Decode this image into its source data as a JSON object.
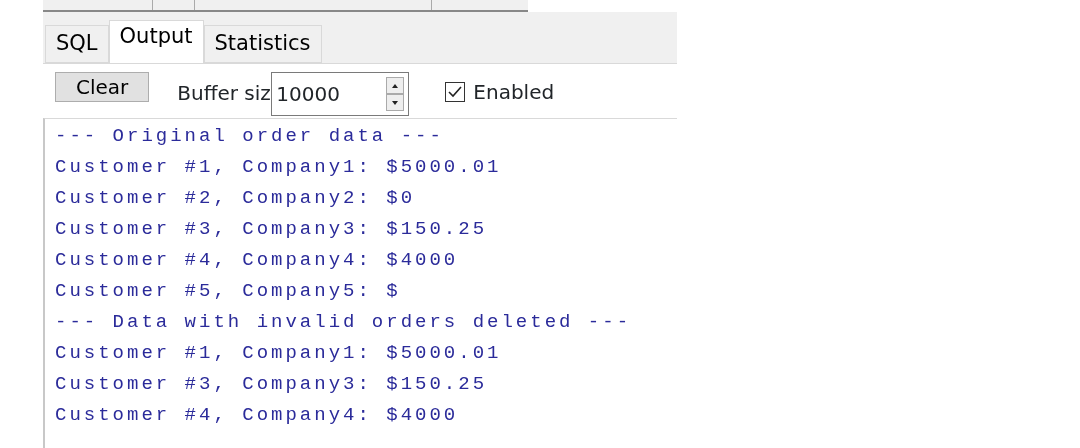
{
  "tabs": [
    {
      "label": "SQL",
      "selected": false
    },
    {
      "label": "Output",
      "selected": true
    },
    {
      "label": "Statistics",
      "selected": false
    }
  ],
  "toolbar": {
    "clear_button": "Clear",
    "buffer_label": "Buffer siz",
    "buffer_size": "10000",
    "enabled": {
      "label": "Enabled",
      "checked": true
    }
  },
  "output_lines": [
    "--- Original order data ---",
    "Customer #1, Company1: $5000.01",
    "Customer #2, Company2: $0",
    "Customer #3, Company3: $150.25",
    "Customer #4, Company4: $4000",
    "Customer #5, Company5: $",
    "--- Data with invalid orders deleted ---",
    "Customer #1, Company1: $5000.01",
    "Customer #3, Company3: $150.25",
    "Customer #4, Company4: $4000"
  ]
}
